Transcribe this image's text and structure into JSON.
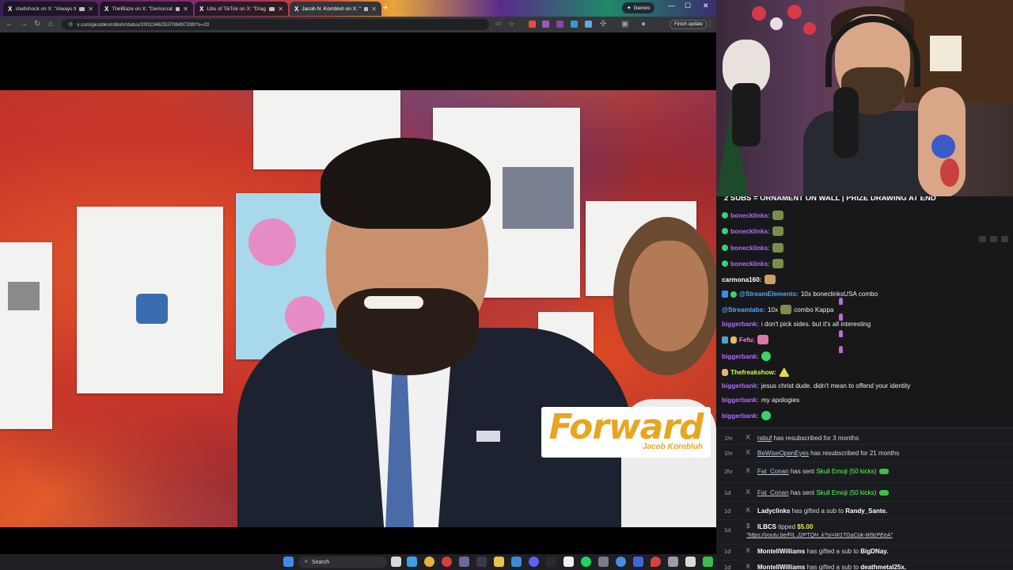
{
  "browser": {
    "tabs": [
      {
        "title": "shellshock on X: \"Always tl",
        "active": false
      },
      {
        "title": "TheBlaze on X: \"Democrat",
        "active": false
      },
      {
        "title": "Libs of TikTok on X: \"Drag",
        "active": false
      },
      {
        "title": "Jacob N. Kornbluh on X: \"",
        "active": true
      }
    ],
    "gemini_label": "Gemini",
    "url": "x.com/jacobkornbluh/status/2001346253708497299?s=20",
    "finish_update_label": "Finish update"
  },
  "video": {
    "logo_word": "Forward",
    "logo_sub": "Jacob Kornbluh"
  },
  "chat": {
    "banner": "2 SUBS = ORNAMENT ON WALL | PRIZE DRAWING AT END",
    "messages": [
      {
        "user": "bonecklinks:",
        "text": "",
        "color": "u-purple"
      },
      {
        "user": "bonecklinks:",
        "text": "",
        "color": "u-purple"
      },
      {
        "user": "bonecklinks:",
        "text": "",
        "color": "u-purple"
      },
      {
        "user": "bonecklinks:",
        "text": "",
        "color": "u-purple"
      },
      {
        "user": "carmona160:",
        "text": "",
        "color": "u-white"
      },
      {
        "user": "@StreamElements:",
        "text": "10x boneclinksUSA combo",
        "color": "u-blue"
      },
      {
        "user": "@Streamlabs:",
        "text": "10x",
        "text2": "combo Kappa",
        "color": "u-blue"
      },
      {
        "user": "biggerbank:",
        "text": "i don't pick sides. but it's all interesting",
        "color": "u-purple"
      },
      {
        "user": "Fefu:",
        "text": "",
        "color": "u-pink"
      },
      {
        "user": "biggerbank:",
        "text": "",
        "color": "u-purple"
      },
      {
        "user": "Thefreakshow:",
        "text": "",
        "color": "u-lime"
      },
      {
        "user": "biggerbank:",
        "text": "jesus christ dude. didn't mean to offend your identity",
        "color": "u-purple"
      },
      {
        "user": "biggerbank:",
        "text": "my apologies",
        "color": "u-purple"
      },
      {
        "user": "biggerbank:",
        "text": "",
        "color": "u-purple"
      }
    ]
  },
  "events": [
    {
      "time": "1hr",
      "user": "rabuf",
      "text": "has resubscribed for 3 months"
    },
    {
      "time": "1hr",
      "user": "BeWiseOpenEyes",
      "text": "has resubscribed for 21 months"
    },
    {
      "time": "2hr",
      "user": "Fat_Conan",
      "text": "has sent",
      "gift": "Skull Emoji (50 kicks)"
    },
    {
      "time": "1d",
      "user": "Fat_Conan",
      "text": "has sent",
      "gift": "Skull Emoji (50 kicks)"
    },
    {
      "time": "1d",
      "user": "Ladyclinks",
      "text": "has gifted a sub to",
      "target": "Randy_Sante."
    },
    {
      "time": "1d",
      "user": "ILBCS",
      "text": "tipped",
      "amount": "$5.00",
      "link": "\"https://youtu.be/FIL J2PTQH_k?si=W1TGaCok-W9cPEeA\""
    },
    {
      "time": "1d",
      "user": "MontellWilliams",
      "text": "has gifted a sub to",
      "target": "BigDNay."
    },
    {
      "time": "1d",
      "user": "MontellWilliams",
      "text": "has gifted a sub to",
      "target": "deathmetal25x."
    }
  ],
  "taskbar": {
    "search_label": "Search"
  }
}
